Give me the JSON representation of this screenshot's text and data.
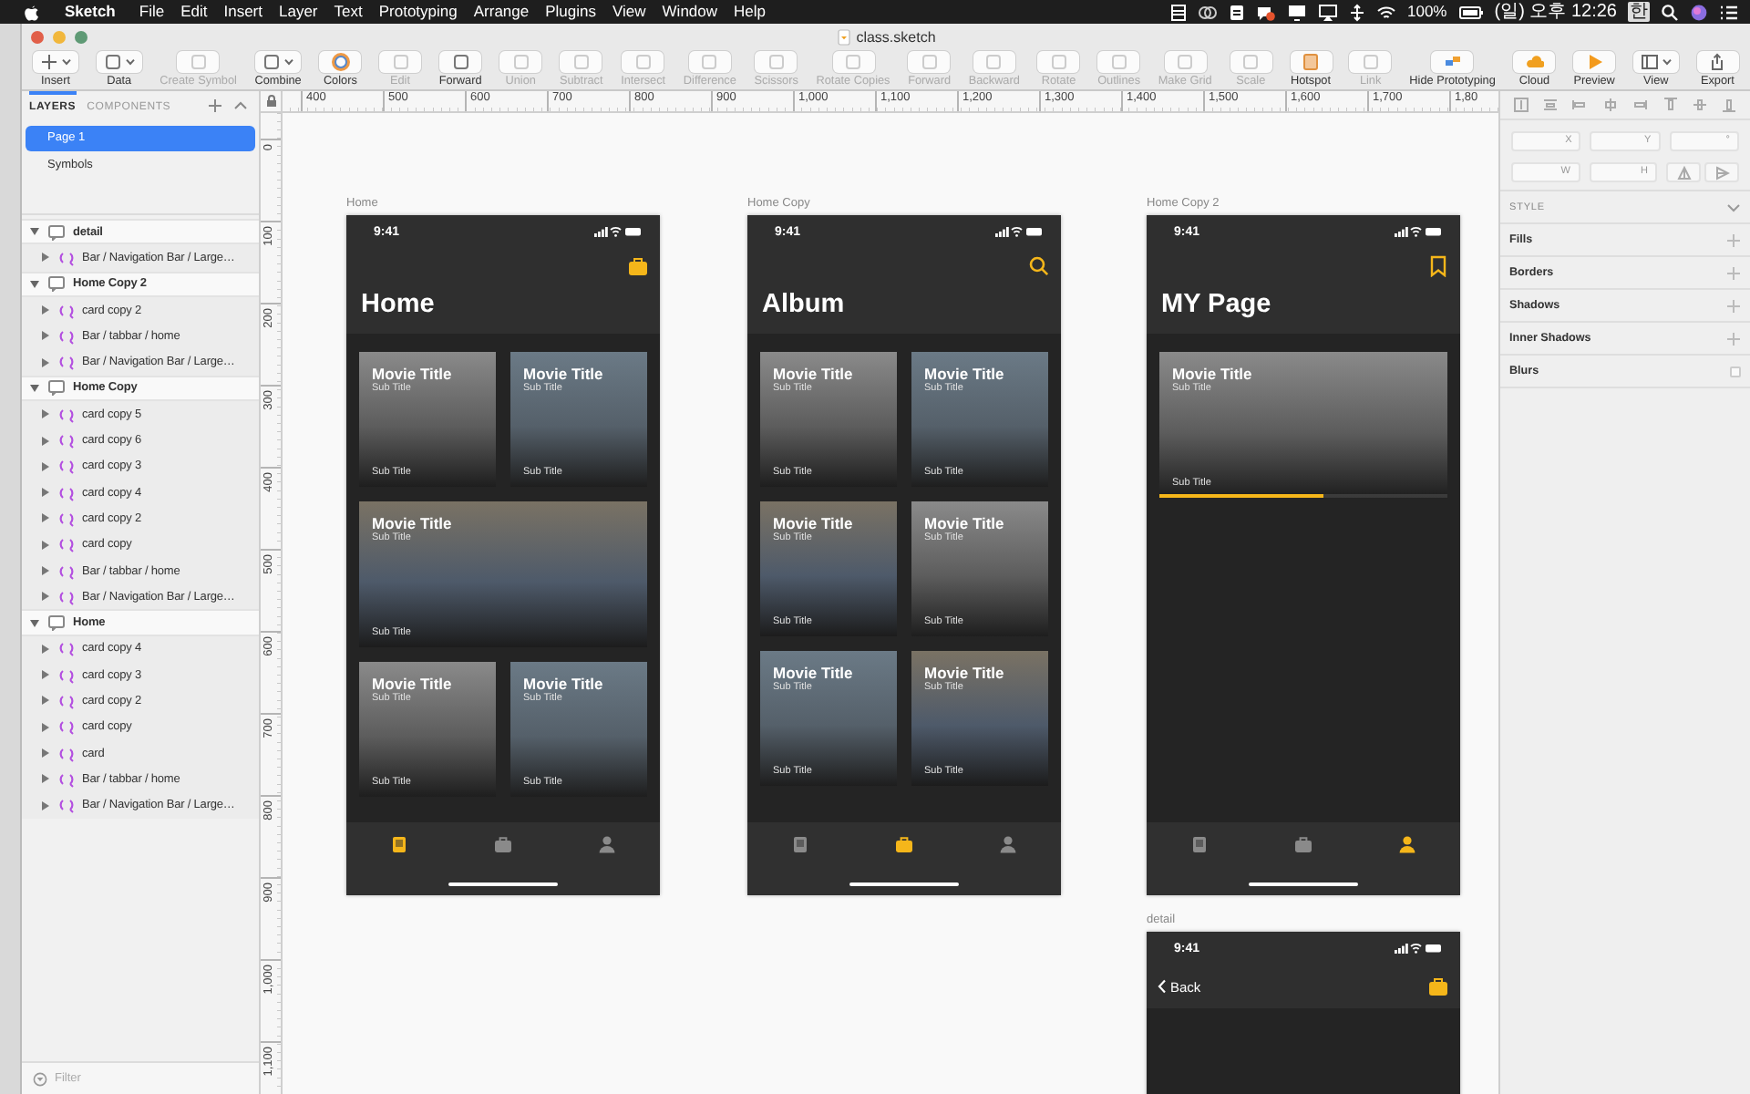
{
  "menu_bar": {
    "app": "Sketch",
    "menus": [
      "File",
      "Edit",
      "Insert",
      "Layer",
      "Text",
      "Prototyping",
      "Arrange",
      "Plugins",
      "View",
      "Window",
      "Help"
    ],
    "battery": "100%",
    "clock": "(일) 오후 12:26",
    "input_source": "한"
  },
  "window": {
    "title": "class.sketch"
  },
  "toolbar": [
    {
      "label": "Insert",
      "disabled": false,
      "dropdown": true
    },
    {
      "label": "Data",
      "disabled": false,
      "dropdown": true
    },
    {
      "label": "Create Symbol",
      "disabled": true,
      "dropdown": false
    },
    {
      "label": "Combine",
      "disabled": false,
      "dropdown": true
    },
    {
      "label": "Colors",
      "disabled": false,
      "dropdown": false
    },
    {
      "label": "Edit",
      "disabled": true,
      "dropdown": false
    },
    {
      "label": "Forward",
      "disabled": false,
      "dropdown": false
    },
    {
      "label": "Union",
      "disabled": true,
      "dropdown": false
    },
    {
      "label": "Subtract",
      "disabled": true,
      "dropdown": false
    },
    {
      "label": "Intersect",
      "disabled": true,
      "dropdown": false
    },
    {
      "label": "Difference",
      "disabled": true,
      "dropdown": false
    },
    {
      "label": "Scissors",
      "disabled": true,
      "dropdown": false
    },
    {
      "label": "Rotate Copies",
      "disabled": true,
      "dropdown": false
    },
    {
      "label": "Forward",
      "disabled": true,
      "dropdown": false
    },
    {
      "label": "Backward",
      "disabled": true,
      "dropdown": false
    },
    {
      "label": "Rotate",
      "disabled": true,
      "dropdown": false
    },
    {
      "label": "Outlines",
      "disabled": true,
      "dropdown": false
    },
    {
      "label": "Make Grid",
      "disabled": true,
      "dropdown": false
    },
    {
      "label": "Scale",
      "disabled": true,
      "dropdown": false
    },
    {
      "label": "Hotspot",
      "disabled": false,
      "dropdown": false
    },
    {
      "label": "Link",
      "disabled": true,
      "dropdown": false
    },
    {
      "label": "Hide Prototyping",
      "disabled": false,
      "dropdown": false
    },
    {
      "label": "Cloud",
      "disabled": false,
      "dropdown": false
    },
    {
      "label": "Preview",
      "disabled": false,
      "dropdown": false
    },
    {
      "label": "View",
      "disabled": false,
      "dropdown": true
    },
    {
      "label": "Export",
      "disabled": false,
      "dropdown": false
    }
  ],
  "layers_panel": {
    "tabs": [
      {
        "label": "LAYERS",
        "selected": true
      },
      {
        "label": "COMPONENTS",
        "selected": false
      }
    ],
    "pages": [
      {
        "label": "Page 1",
        "selected": true
      },
      {
        "label": "Symbols",
        "selected": false
      }
    ],
    "tree": [
      {
        "name": "detail",
        "expanded": true,
        "children": [
          {
            "name": "Bar / Navigation Bar / Large…",
            "expanded": false
          }
        ]
      },
      {
        "name": "Home Copy 2",
        "expanded": true,
        "children": [
          {
            "name": "card copy 2",
            "expanded": false
          },
          {
            "name": "Bar / tabbar / home",
            "expanded": false
          },
          {
            "name": "Bar / Navigation Bar / Large…",
            "expanded": false
          }
        ]
      },
      {
        "name": "Home Copy",
        "expanded": true,
        "children": [
          {
            "name": "card copy 5",
            "expanded": false
          },
          {
            "name": "card copy 6",
            "expanded": false
          },
          {
            "name": "card copy 3",
            "expanded": false
          },
          {
            "name": "card copy 4",
            "expanded": false
          },
          {
            "name": "card copy 2",
            "expanded": false
          },
          {
            "name": "card copy",
            "expanded": false
          },
          {
            "name": "Bar / tabbar / home",
            "expanded": false
          },
          {
            "name": "Bar / Navigation Bar / Large…",
            "expanded": false
          }
        ]
      },
      {
        "name": "Home",
        "expanded": true,
        "children": [
          {
            "name": "card copy 4",
            "expanded": false
          },
          {
            "name": "card copy 3",
            "expanded": false
          },
          {
            "name": "card copy 2",
            "expanded": false
          },
          {
            "name": "card copy",
            "expanded": false
          },
          {
            "name": "card",
            "expanded": false
          },
          {
            "name": "Bar / tabbar / home",
            "expanded": false
          },
          {
            "name": "Bar / Navigation Bar / Large…",
            "expanded": false
          }
        ]
      }
    ],
    "filter": {
      "placeholder": "Filter"
    }
  },
  "ruler": {
    "horizontal": [
      "400",
      "500",
      "600",
      "700",
      "800",
      "900",
      "1,000",
      "1,100",
      "1,200",
      "1,300",
      "1,400",
      "1,500",
      "1,600",
      "1,700",
      "1,80"
    ],
    "vertical": [
      "0",
      "100",
      "200",
      "300",
      "400",
      "500",
      "600",
      "700",
      "800",
      "900",
      "1,000",
      "1,100"
    ]
  },
  "artboards": [
    {
      "label": "Home",
      "kind": "tab_page",
      "time": "9:41",
      "title": "Home",
      "cards": [
        {
          "title": "Movie Title",
          "subtitle": "Sub Title",
          "caption": "Sub Title",
          "wide": false
        },
        {
          "title": "Movie Title",
          "subtitle": "Sub Title",
          "caption": "Sub Title",
          "wide": false
        },
        {
          "title": "Movie Title",
          "subtitle": "Sub Title",
          "caption": "Sub Title",
          "wide": true
        },
        {
          "title": "Movie Title",
          "subtitle": "Sub Title",
          "caption": "Sub Title",
          "wide": false
        },
        {
          "title": "Movie Title",
          "subtitle": "Sub Title",
          "caption": "Sub Title",
          "wide": false
        }
      ],
      "tabs": [
        {
          "selected": true
        },
        {
          "selected": false
        },
        {
          "selected": false
        }
      ]
    },
    {
      "label": "Home Copy",
      "kind": "tab_page",
      "time": "9:41",
      "title": "Album",
      "cards": [
        {
          "title": "Movie Title",
          "subtitle": "Sub Title",
          "caption": "Sub Title",
          "wide": false
        },
        {
          "title": "Movie Title",
          "subtitle": "Sub Title",
          "caption": "Sub Title",
          "wide": false
        },
        {
          "title": "Movie Title",
          "subtitle": "Sub Title",
          "caption": "Sub Title",
          "wide": false
        },
        {
          "title": "Movie Title",
          "subtitle": "Sub Title",
          "caption": "Sub Title",
          "wide": false
        },
        {
          "title": "Movie Title",
          "subtitle": "Sub Title",
          "caption": "Sub Title",
          "wide": false
        },
        {
          "title": "Movie Title",
          "subtitle": "Sub Title",
          "caption": "Sub Title",
          "wide": false
        }
      ],
      "tabs": [
        {
          "selected": false
        },
        {
          "selected": true
        },
        {
          "selected": false
        }
      ]
    },
    {
      "label": "Home Copy 2",
      "kind": "tab_page",
      "time": "9:41",
      "title": "MY Page",
      "cards": [
        {
          "title": "Movie Title",
          "subtitle": "Sub Title",
          "caption": "Sub Title",
          "wide": true,
          "progress": {
            "level": 0.57
          }
        }
      ],
      "tabs": [
        {
          "selected": false
        },
        {
          "selected": false
        },
        {
          "selected": true
        }
      ]
    },
    {
      "label": "detail",
      "kind": "detail",
      "time": "9:41",
      "back": "Back"
    }
  ],
  "inspector": {
    "fields": [
      {
        "label": "X"
      },
      {
        "label": "Y"
      },
      {
        "label": "°"
      },
      {
        "label": "W"
      },
      {
        "label": "H"
      }
    ],
    "style": {
      "title": "STYLE",
      "sections": [
        {
          "label": "Fills",
          "kind": "add"
        },
        {
          "label": "Borders",
          "kind": "add"
        },
        {
          "label": "Shadows",
          "kind": "add"
        },
        {
          "label": "Inner Shadows",
          "kind": "add"
        },
        {
          "label": "Blurs",
          "kind": "toggle",
          "checked": false
        }
      ]
    }
  }
}
